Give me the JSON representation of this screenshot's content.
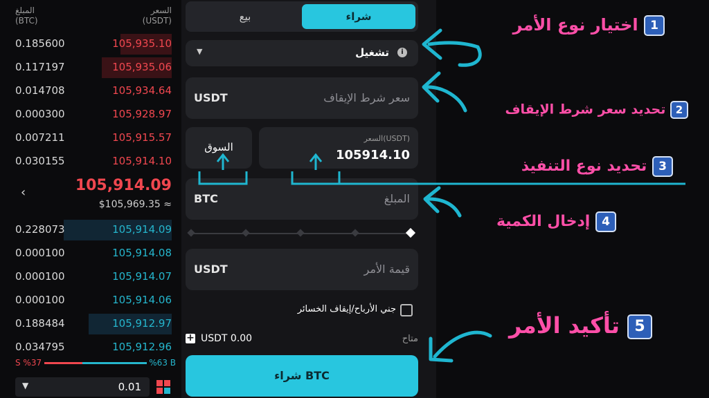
{
  "orderbook": {
    "header_amount": "المبلغ",
    "header_amount_unit": "(BTC)",
    "header_price": "السعر",
    "header_price_unit": "(USDT)",
    "asks": [
      {
        "amount": "0.185600",
        "price": "105,935.10",
        "depth": 0.31
      },
      {
        "amount": "0.117197",
        "price": "105,935.06",
        "depth": 0.42
      },
      {
        "amount": "0.014708",
        "price": "105,934.64",
        "depth": 0.0
      },
      {
        "amount": "0.000300",
        "price": "105,928.97",
        "depth": 0.0
      },
      {
        "amount": "0.007211",
        "price": "105,915.57",
        "depth": 0.0
      },
      {
        "amount": "0.030155",
        "price": "105,914.10",
        "depth": 0.0
      }
    ],
    "last_price": "105,914.09",
    "last_price_usd": "$105,969.35 ≈",
    "bids": [
      {
        "amount": "0.228073",
        "price": "105,914.09",
        "depth": 0.65
      },
      {
        "amount": "0.000100",
        "price": "105,914.08",
        "depth": 0.0
      },
      {
        "amount": "0.000100",
        "price": "105,914.07",
        "depth": 0.0
      },
      {
        "amount": "0.000100",
        "price": "105,914.06",
        "depth": 0.0
      },
      {
        "amount": "0.188484",
        "price": "105,912.97",
        "depth": 0.5
      },
      {
        "amount": "0.034795",
        "price": "105,912.96",
        "depth": 0.0
      }
    ],
    "sell_ratio": "S %37",
    "buy_ratio": "%63 B",
    "sell_ratio_value": 0.37,
    "step_value": "0.01"
  },
  "form": {
    "tab_buy": "شراء",
    "tab_sell": "بيع",
    "order_type": "تشغيل",
    "stop_price_label": "سعر شرط الإيقاف",
    "stop_price_unit": "USDT",
    "market_label": "السوق",
    "price_label": "السعر(USDT)",
    "price_value": "105914.10",
    "amount_label": "المبلغ",
    "amount_unit": "BTC",
    "order_value_label": "قيمة الأمر",
    "order_value_unit": "USDT",
    "tpsl_label": "جني الأرباح/إيقاف الخسائر",
    "available_label": "متاح",
    "available_value": "USDT 0.00",
    "buy_button": "شراء BTC"
  },
  "annotations": {
    "step1": "اختيار نوع الأمر",
    "step2": "تحديد سعر شرط الإيقاف",
    "step3": "تحديد نوع التنفيذ",
    "step4": "إدخال الكمية",
    "step5": "تأكيد الأمر",
    "n1": "1",
    "n2": "2",
    "n3": "3",
    "n4": "4",
    "n5": "5"
  },
  "colors": {
    "accent": "#28c6df",
    "ask": "#f0474f",
    "bid": "#25b6cd",
    "annotation": "#ff4fa8"
  }
}
